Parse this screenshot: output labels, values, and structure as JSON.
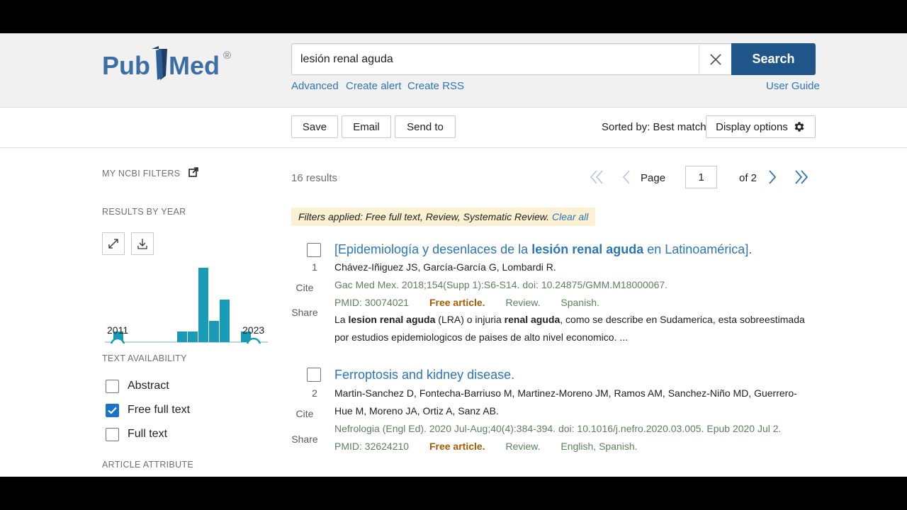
{
  "search": {
    "query": "lesión renal aguda",
    "button": "Search"
  },
  "header_links": {
    "advanced": "Advanced",
    "create_alert": "Create alert",
    "create_rss": "Create RSS",
    "user_guide": "User Guide"
  },
  "toolbar": {
    "save": "Save",
    "email": "Email",
    "send_to": "Send to",
    "sorted_by": "Sorted by: Best match",
    "display_options": "Display options"
  },
  "sidebar": {
    "my_ncbi_filters": "MY NCBI FILTERS",
    "results_by_year": "RESULTS BY YEAR",
    "year_start": "2011",
    "year_end": "2023",
    "year_counts": [
      1,
      0,
      0,
      0,
      0,
      0,
      1,
      1,
      7,
      2,
      4,
      0,
      1
    ],
    "text_availability": "TEXT AVAILABILITY",
    "text_options": [
      {
        "label": "Abstract",
        "checked": false
      },
      {
        "label": "Free full text",
        "checked": true
      },
      {
        "label": "Full text",
        "checked": false
      }
    ],
    "article_attribute": "ARTICLE ATTRIBUTE"
  },
  "results": {
    "count": "16 results",
    "page_label": "Page",
    "page_value": "1",
    "of_pages": "of 2",
    "filters_applied": "Filters applied: Free full text, Review, Systematic Review.",
    "clear_all": "Clear all"
  },
  "articles": [
    {
      "num": "1",
      "title_pre": "[Epidemiología y desenlaces de la ",
      "title_bold": "lesión renal aguda",
      "title_post": " en Latinoamérica].",
      "authors": "Chávez-Iñiguez JS, García-García G, Lombardi R.",
      "journal": "Gac Med Mex. 2018;154(Supp 1):S6-S14. doi: 10.24875/GMM.M18000067.",
      "pmid": "PMID: 30074021",
      "free": "Free article.",
      "review": "Review.",
      "lang": "Spanish.",
      "snippet1_a": "La ",
      "snippet1_b": "lesion renal aguda",
      "snippet1_c": " (LRA) o injuria ",
      "snippet1_d": "renal aguda",
      "snippet1_e": ", como se describe en Sudamerica, esta sobreestimada",
      "snippet2": "por estudios epidemiologicos de paises de alto nivel economico. ...",
      "cite": "Cite",
      "share": "Share"
    },
    {
      "num": "2",
      "title": "Ferroptosis and kidney disease.",
      "authors1": "Martin-Sanchez D, Fontecha-Barriuso M, Martinez-Moreno JM, Ramos AM, Sanchez-Niño MD, Guerrero-",
      "authors2": "Hue M, Moreno JA, Ortiz A, Sanz AB.",
      "journal": "Nefrologia (Engl Ed). 2020 Jul-Aug;40(4):384-394. doi: 10.1016/j.nefro.2020.03.005. Epub 2020 Jul 2.",
      "pmid": "PMID: 32624210",
      "free": "Free article.",
      "review": "Review.",
      "lang": "English, Spanish.",
      "cite": "Cite",
      "share": "Share"
    }
  ],
  "colors": {
    "brand": "#20558a",
    "link": "#2e75b6",
    "chart_bar": "#1a9bb5",
    "free": "#a35a00"
  }
}
